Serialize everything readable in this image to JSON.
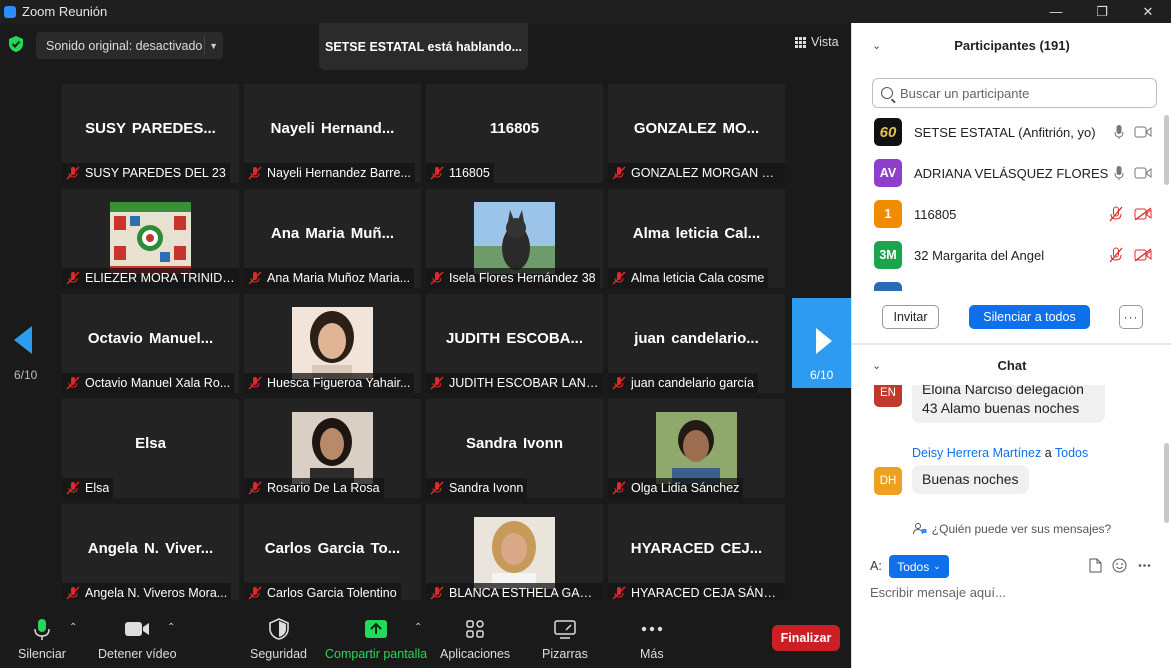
{
  "window": {
    "title": "Zoom Reunión",
    "buttons": [
      "—",
      "❐",
      "✕"
    ]
  },
  "topbar": {
    "audio_label": "Sonido original: desactivado",
    "speaking_label": "SETSE ESTATAL está hablando...",
    "view_label": "Vista"
  },
  "pager": {
    "left": "6/10",
    "right": "6/10"
  },
  "tiles": [
    {
      "big": "SUSY PAREDES...",
      "label": "SUSY PAREDES DEL 23"
    },
    {
      "big": "Nayeli Hernand...",
      "label": "Nayeli Hernandez Barre..."
    },
    {
      "big": "116805",
      "label": "116805"
    },
    {
      "big": "GONZALEZ MO...",
      "label": "GONZALEZ MORGAN VI..."
    },
    {
      "big": "",
      "label": "ELIEZER MORA TRINIDAD"
    },
    {
      "big": "Ana Maria Muñ...",
      "label": "Ana Maria Muñoz Maria..."
    },
    {
      "big": "",
      "label": "Isela Flores Hernández 38"
    },
    {
      "big": "Alma leticia Cal...",
      "label": "Alma leticia Cala cosme"
    },
    {
      "big": "Octavio Manuel...",
      "label": "Octavio Manuel Xala Ro..."
    },
    {
      "big": "",
      "label": "Huesca Figueroa Yahair..."
    },
    {
      "big": "JUDITH ESCOBA...",
      "label": "JUDITH ESCOBAR LANDA"
    },
    {
      "big": "juan candelario...",
      "label": "juan candelario garcía"
    },
    {
      "big": "Elsa",
      "label": "Elsa"
    },
    {
      "big": "",
      "label": "Rosario De La Rosa"
    },
    {
      "big": "Sandra Ivonn",
      "label": "Sandra Ivonn"
    },
    {
      "big": "",
      "label": "Olga Lidia Sánchez"
    },
    {
      "big": "Angela N. Viver...",
      "label": "Angela N. Viveros Mora..."
    },
    {
      "big": "Carlos Garcia To...",
      "label": "Carlos Garcia Tolentino"
    },
    {
      "big": "",
      "label": "BLANCA ESTHELA GARCI..."
    },
    {
      "big": "HYARACED CEJ...",
      "label": "HYARACED CEJA SÁNCH..."
    }
  ],
  "toolbar": {
    "mute": "Silenciar",
    "video": "Detener vídeo",
    "security": "Seguridad",
    "share": "Compartir pantalla",
    "apps": "Aplicaciones",
    "whiteboards": "Pizarras",
    "more": "Más",
    "end": "Finalizar"
  },
  "participants": {
    "title": "Participantes (191)",
    "search_placeholder": "Buscar un participante",
    "list": [
      {
        "avatar": "60",
        "name": "SETSE ESTATAL (Anfitrión, yo)",
        "color": "#111111"
      },
      {
        "avatar": "AV",
        "name": "ADRIANA VELÁSQUEZ FLORES",
        "color": "#8e3fc9"
      },
      {
        "avatar": "1",
        "name": "116805",
        "color": "#f08c00"
      },
      {
        "avatar": "3M",
        "name": "32 Margarita del Angel",
        "color": "#1ba34e"
      }
    ],
    "invite": "Invitar",
    "mute_all": "Silenciar a todos",
    "more": "···"
  },
  "chat": {
    "title": "Chat",
    "msg1_avatar": "EN",
    "msg1_lines": [
      "Eloina Narciso delegación",
      "43 Alamo buenas noches"
    ],
    "msg2_sender": "Deisy Herrera Martínez",
    "msg2_connector": "a",
    "msg2_target": "Todos",
    "msg2_avatar": "DH",
    "msg2_text": "Buenas noches",
    "who_can_see": "¿Quién puede ver sus mensajes?",
    "to_label": "A:",
    "to_value": "Todos",
    "input_placeholder": "Escribir mensaje aquí..."
  },
  "colors": {
    "accent": "#0e71eb",
    "end": "#cc1f25",
    "share": "#23d959",
    "pager": "#2d9cf0"
  }
}
